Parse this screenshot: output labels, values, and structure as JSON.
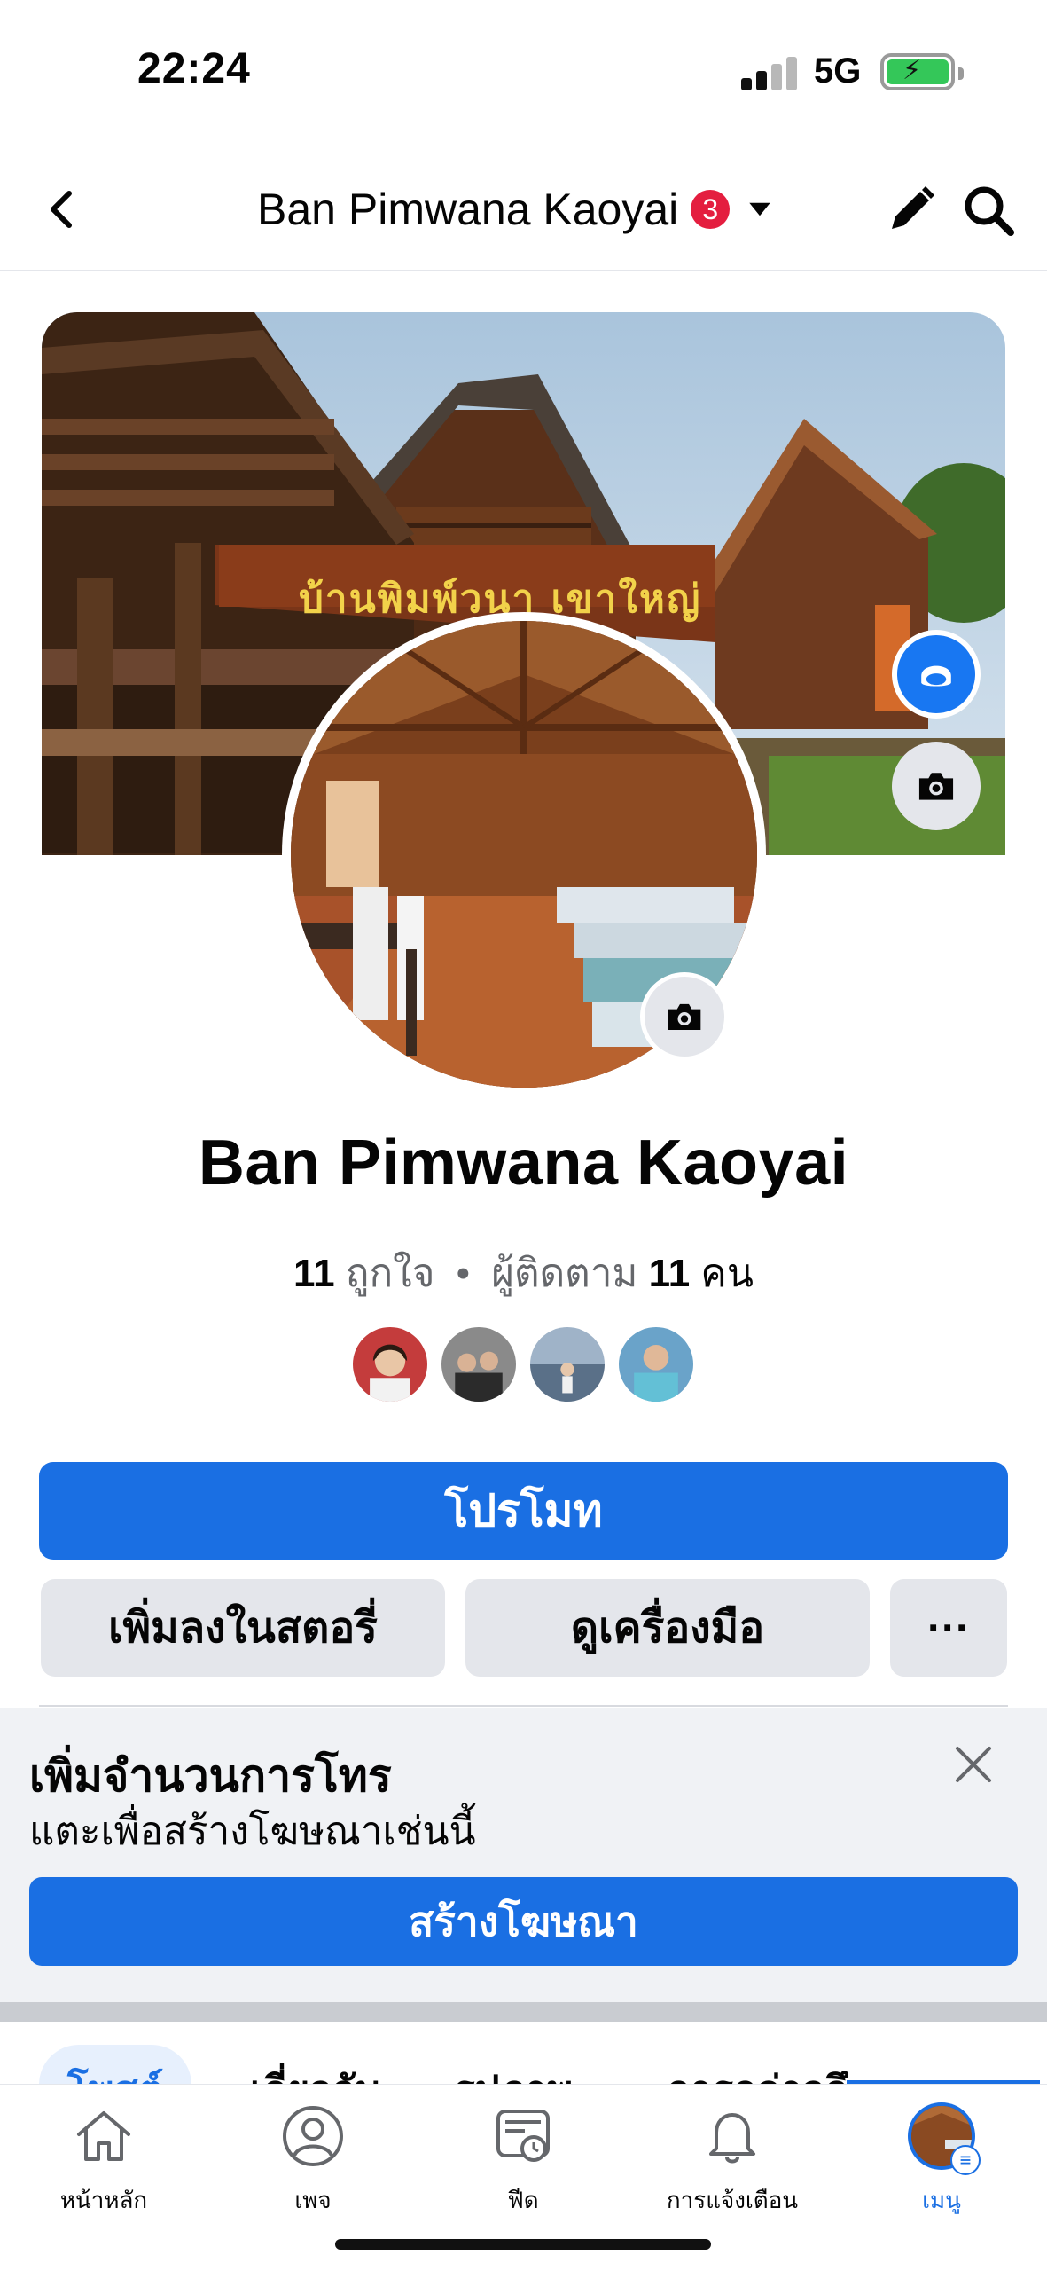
{
  "status_bar": {
    "time": "22:24",
    "network": "5G",
    "battery_charging": true
  },
  "header": {
    "title": "Ban Pimwana Kaoyai",
    "notification_count": "3",
    "back_icon": "chevron-left-icon",
    "edit_icon": "pencil-icon",
    "search_icon": "search-icon"
  },
  "profile": {
    "cover_sign_text": "บ้านพิมพ์วนา เขาใหญ่",
    "name": "Ban Pimwana Kaoyai",
    "likes_count": "11",
    "likes_label": "ถูกใจ",
    "separator": "•",
    "followers_label": "ผู้ติดตาม",
    "followers_count": "11",
    "followers_unit": "คน"
  },
  "actions": {
    "promote": "โปรโมท",
    "add_to_story": "เพิ่มลงในสตอรี่",
    "view_tools": "ดูเครื่องมือ",
    "more": "···"
  },
  "ad_banner": {
    "title": "เพิ่มจำนวนการโทร",
    "subtitle": "แตะเพื่อสร้างโฆษณาเช่นนี้",
    "button": "สร้างโฆษณา"
  },
  "tabs": [
    {
      "label": "โพสต์",
      "active": true
    },
    {
      "label": "เกี่ยวกับ",
      "active": false
    },
    {
      "label": "รูปภาพ",
      "active": false
    },
    {
      "label": "การกล่าวถึง",
      "active": false
    }
  ],
  "bottom_nav": [
    {
      "label": "หน้าหลัก",
      "icon": "home-icon",
      "active": false
    },
    {
      "label": "เพจ",
      "icon": "profile-icon",
      "active": false
    },
    {
      "label": "ฟีด",
      "icon": "feed-icon",
      "active": false
    },
    {
      "label": "การแจ้งเตือน",
      "icon": "bell-icon",
      "active": false
    },
    {
      "label": "เมนู",
      "icon": "menu-avatar-icon",
      "active": true
    }
  ],
  "colors": {
    "brand_blue": "#1a6fe3",
    "badge_red": "#e41e3f",
    "gray_button": "#e4e6eb"
  }
}
